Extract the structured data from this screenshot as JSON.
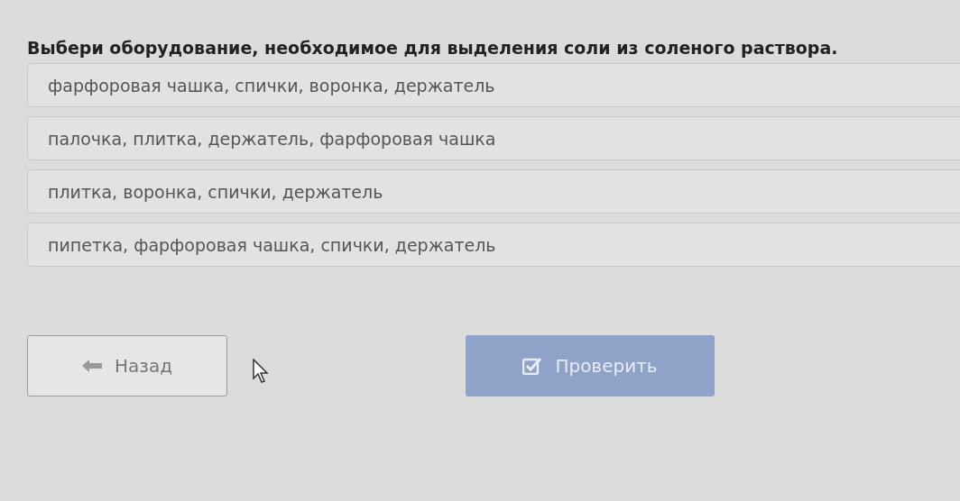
{
  "question": "Выбери оборудование, необходимое для выделения соли из соленого раствора.",
  "options": [
    {
      "label": "фарфоровая чашка, спички, воронка, держатель"
    },
    {
      "label": "палочка, плитка, держатель, фарфоровая чашка"
    },
    {
      "label": "плитка, воронка, спички, держатель"
    },
    {
      "label": "пипетка, фарфоровая чашка, спички, держатель"
    }
  ],
  "buttons": [
    {
      "kind": "back",
      "label": "Назад",
      "disabled": false
    },
    {
      "kind": "check",
      "label": "Проверить",
      "disabled": true
    }
  ]
}
